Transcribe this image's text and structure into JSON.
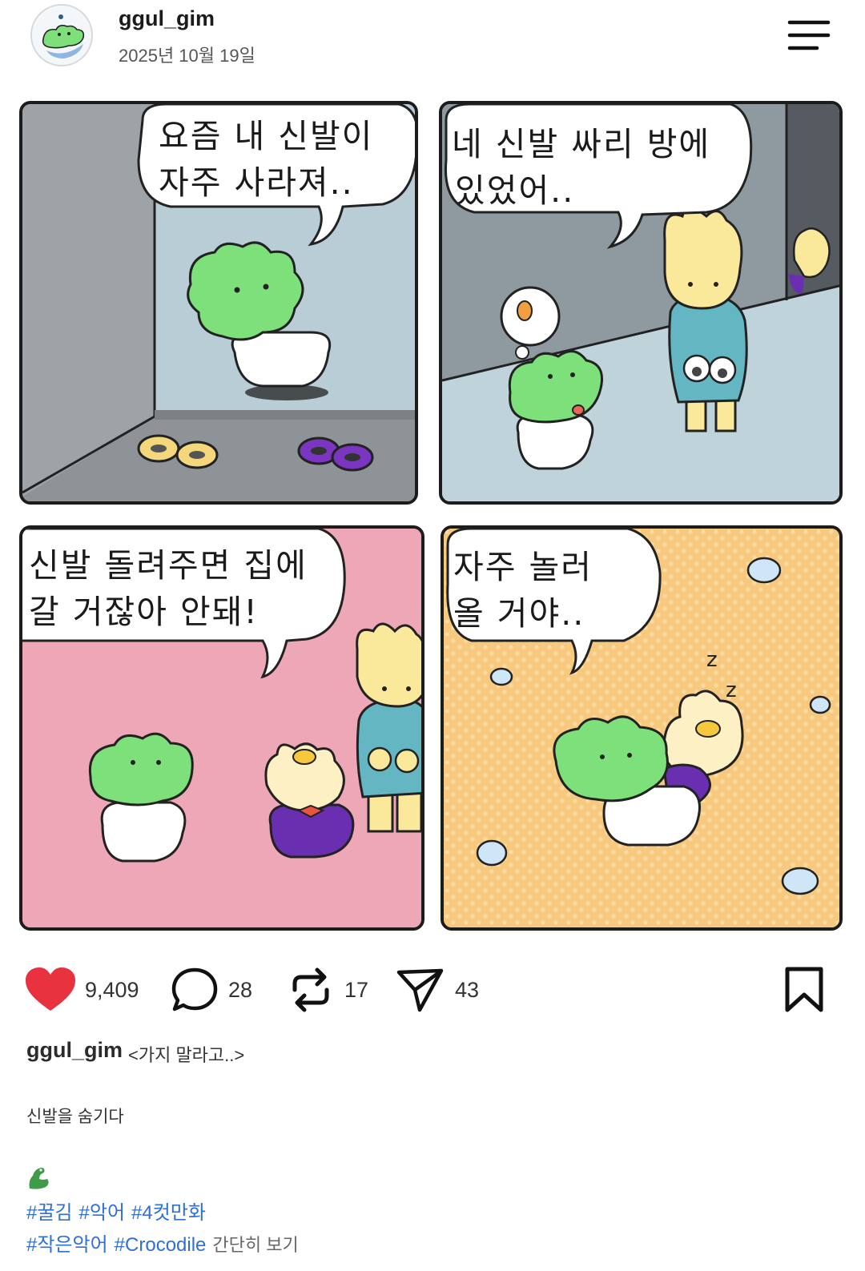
{
  "post": {
    "username": "ggul_gim",
    "date": "2025년 10월 19일"
  },
  "comic": {
    "panels": [
      {
        "line1": "요즘 내 신발이",
        "line2": "자주 사라져.."
      },
      {
        "line1": "네 신발 싸리 방에",
        "line2": "있었어.."
      },
      {
        "line1": "신발 돌려주면 집에",
        "line2": "갈 거잖아 안돼!"
      },
      {
        "line1": "자주 놀러",
        "line2": "올 거야.."
      }
    ],
    "colors": {
      "croc_green": "#7ee07a",
      "bunny_yellow": "#fbe99b",
      "purple": "#6a2fb0",
      "panel3_bg": "#eea7b6",
      "panel4_bg": "#f6c97e"
    }
  },
  "actions": {
    "likes": "9,409",
    "comments": "28",
    "reposts": "17",
    "shares": "43",
    "like_color": "#e8323f"
  },
  "caption": {
    "username": "ggul_gim",
    "title": "<가지 말라고..>",
    "body": "신발을 숨기다",
    "emoji": "crocodile-emoji",
    "tags_line1": [
      "#꿀김",
      "#악어",
      "#4컷만화"
    ],
    "tags_line2": [
      "#작은악어",
      "#Crocodile"
    ],
    "see_less": "간단히 보기"
  },
  "icons": [
    "menu-icon",
    "heart-icon",
    "comment-icon",
    "repost-icon",
    "share-icon",
    "bookmark-icon"
  ]
}
